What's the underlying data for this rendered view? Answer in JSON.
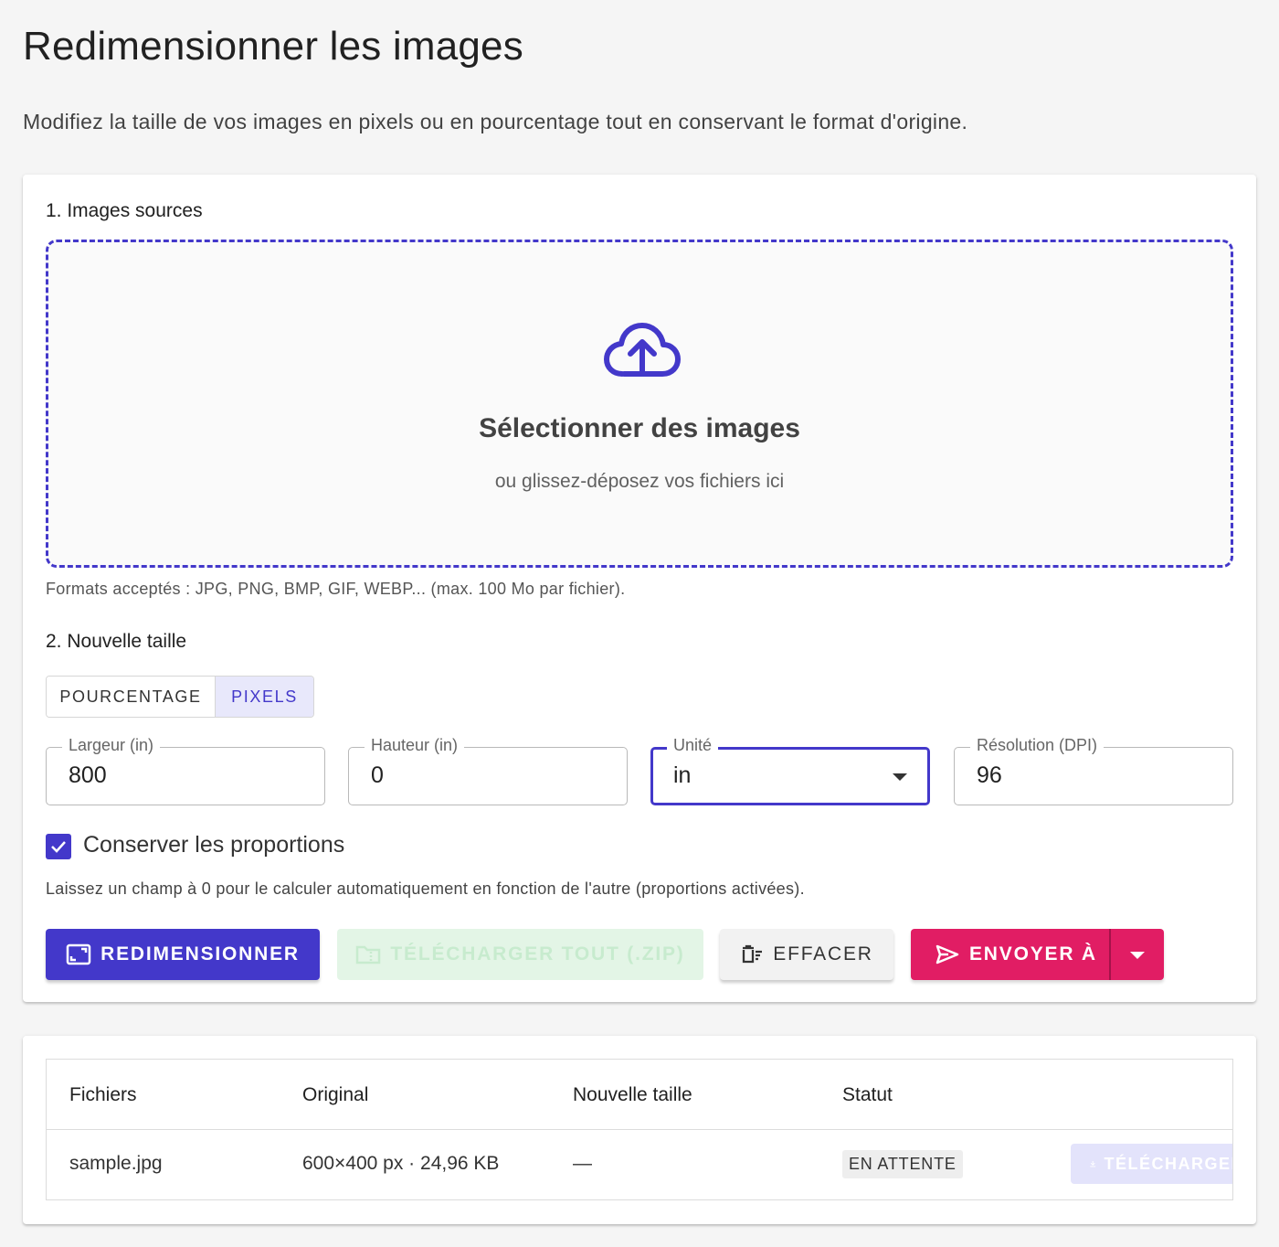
{
  "page": {
    "title": "Redimensionner les images",
    "subtitle": "Modifiez la taille de vos images en pixels ou en pourcentage tout en conservant le format d'origine."
  },
  "sources": {
    "section_title": "1. Images sources",
    "dropzone_title": "Sélectionner des images",
    "dropzone_hint": "ou glissez-déposez vos fichiers ici",
    "formats_note": "Formats acceptés : JPG, PNG, BMP, GIF, WEBP... (max. 100 Mo par fichier)."
  },
  "size": {
    "section_title": "2. Nouvelle taille",
    "mode_options": [
      "POURCENTAGE",
      "PIXELS"
    ],
    "mode_selected": "PIXELS",
    "fields": {
      "width": {
        "label": "Largeur (in)",
        "value": "800"
      },
      "height": {
        "label": "Hauteur (in)",
        "value": "0"
      },
      "unit": {
        "label": "Unité",
        "value": "in"
      },
      "resolution": {
        "label": "Résolution (DPI)",
        "value": "96"
      }
    },
    "keep_ratio": {
      "label": "Conserver les proportions",
      "checked": true
    },
    "help_text": "Laissez un champ à 0 pour le calculer automatiquement en fonction de l'autre (proportions activées)."
  },
  "actions": {
    "resize": "REDIMENSIONNER",
    "download_zip": "TÉLÉCHARGER TOUT (.ZIP)",
    "clear": "EFFACER",
    "send_to": "ENVOYER À"
  },
  "table": {
    "headers": [
      "Fichiers",
      "Original",
      "Nouvelle taille",
      "Statut"
    ],
    "rows": [
      {
        "file": "sample.jpg",
        "original": "600×400 px · 24,96 KB",
        "new_size": "—",
        "status": "EN ATTENTE",
        "action": "TÉLÉCHARGER"
      }
    ]
  },
  "colors": {
    "primary": "#4338ca",
    "accent": "#e11d64",
    "success_disabled": "#e3f5e6"
  }
}
